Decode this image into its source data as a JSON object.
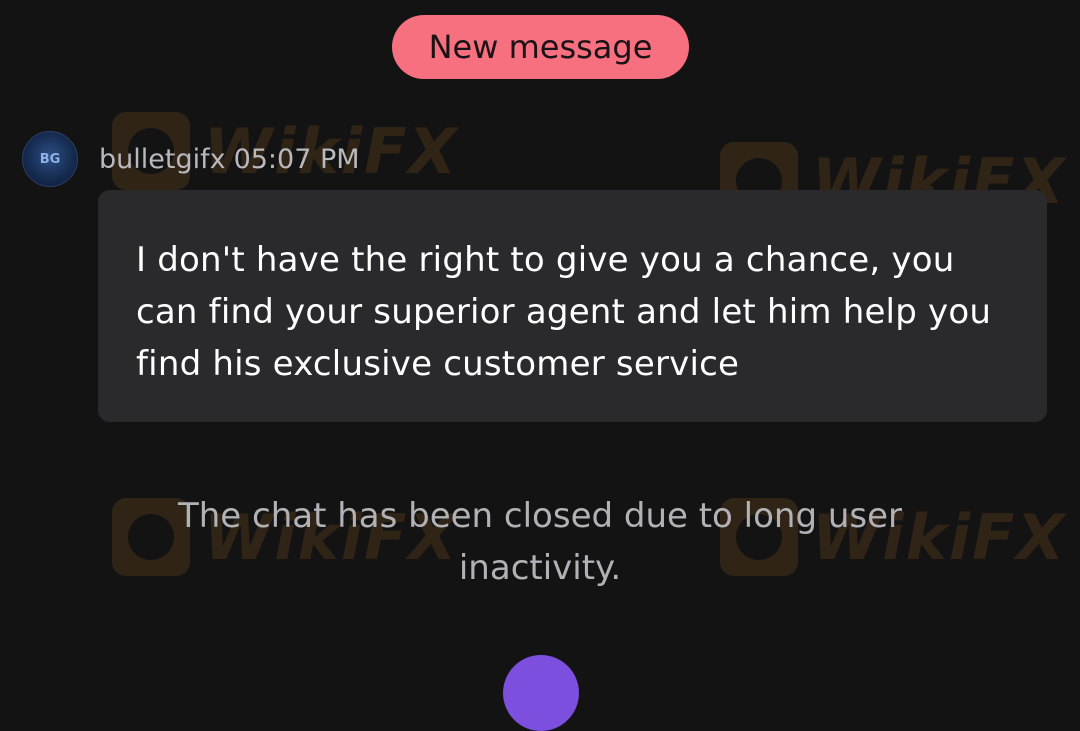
{
  "banner": {
    "new_message_label": "New message"
  },
  "watermark": {
    "text": "WikiFX"
  },
  "message": {
    "avatar_text": "BG",
    "sender": "bulletgifx",
    "time": "05:07 PM",
    "text": "I don't have the right to give you a chance, you can find your superior agent and let him help you find his exclusive customer service"
  },
  "system_note": {
    "text": "The chat has been closed due to long user inactivity."
  },
  "colors": {
    "background": "#141314",
    "pill": "#f7707f",
    "bubble": "#2a2a2c",
    "fab": "#7c4fdf",
    "watermark": "#e59a2a"
  }
}
